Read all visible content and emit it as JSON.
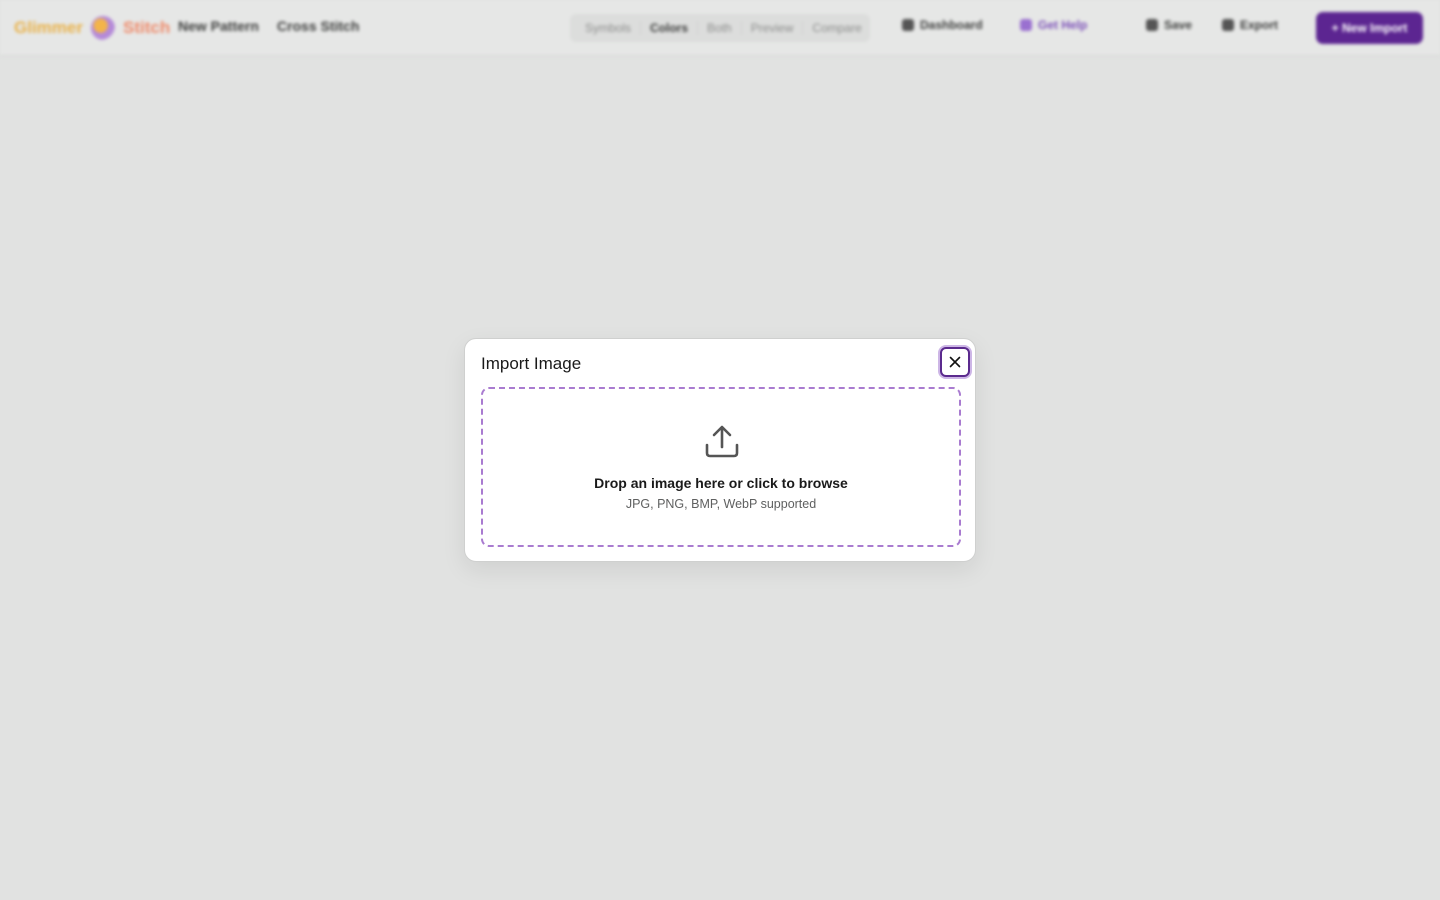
{
  "topbar": {
    "logo_word1": "Glimmer",
    "logo_word2": "Stitch",
    "nav": [
      "New Pattern",
      "Cross Stitch"
    ],
    "segments": [
      "Symbols",
      "Colors",
      "Both",
      "Preview",
      "Compare"
    ],
    "dashboard_label": "Dashboard",
    "help_label": "Get Help",
    "save_label": "Save",
    "export_label": "Export",
    "new_import_label": "+ New Import"
  },
  "modal": {
    "title": "Import Image",
    "close_icon": "close-icon",
    "dropzone": {
      "icon": "upload-icon",
      "primary_text": "Drop an image here or click to browse",
      "secondary_text": "JPG, PNG, BMP, WebP supported"
    }
  },
  "colors": {
    "accent": "#5c2591",
    "dropzone_border": "#a97bd0",
    "overlay_bg": "#e1e2e1"
  }
}
